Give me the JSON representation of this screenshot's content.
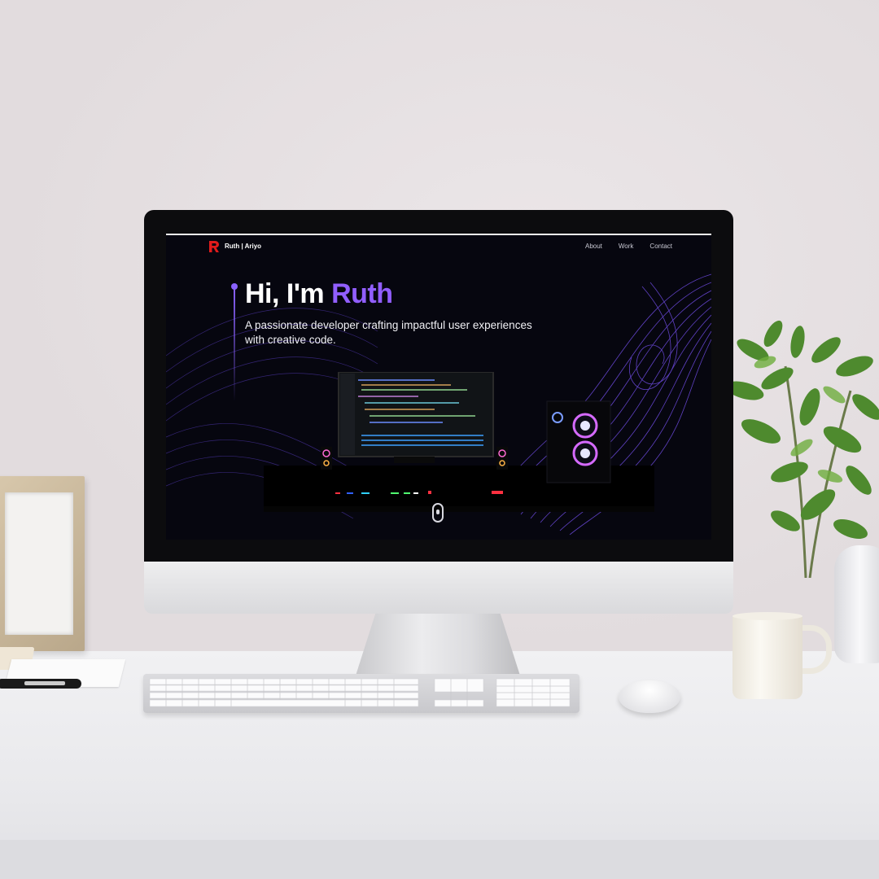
{
  "website": {
    "nav": {
      "brand": "Ruth | Ariyo",
      "links": [
        "About",
        "Work",
        "Contact"
      ]
    },
    "hero": {
      "greeting": "Hi, I'm ",
      "name": "Ruth",
      "subtitle": "A passionate developer crafting impactful user experiences with creative code."
    }
  },
  "colors": {
    "accent": "#915eff",
    "logo": "#e11b1b",
    "screen_bg": "#06060f"
  },
  "icons": [
    "logo-r-icon",
    "scroll-indicator-icon"
  ]
}
